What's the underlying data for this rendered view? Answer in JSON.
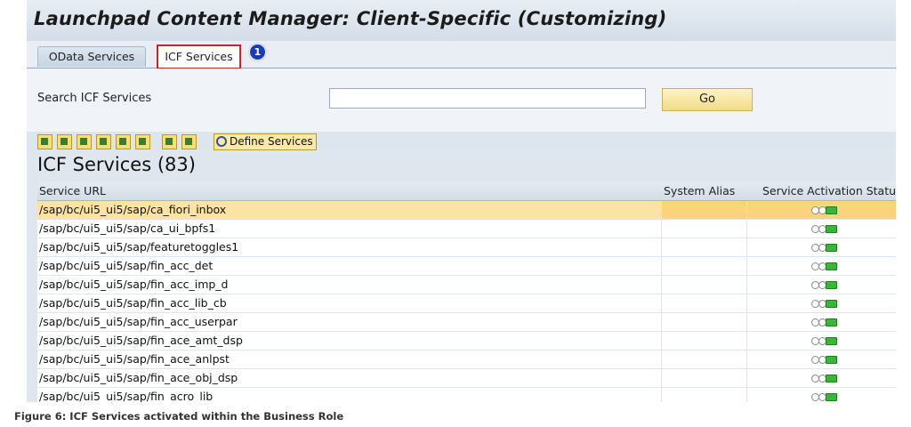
{
  "window": {
    "title": "Launchpad Content Manager: Client-Specific (Customizing)"
  },
  "tabs": [
    {
      "label": "OData Services",
      "active": false
    },
    {
      "label": "ICF Services",
      "active": true
    }
  ],
  "callout_badge": "1",
  "search": {
    "label": "Search ICF Services",
    "value": "",
    "go_label": "Go"
  },
  "toolbar": {
    "icons": [
      "details-icon",
      "upload-icon",
      "align-icon",
      "find-icon",
      "find-next-icon",
      "filter-icon",
      "export-icon",
      "layout-icon"
    ],
    "define_label": "Define Services"
  },
  "table": {
    "title": "ICF Services (83)",
    "columns": [
      "Service URL",
      "System Alias",
      "Service Activation Status"
    ],
    "rows": [
      {
        "url": "/sap/bc/ui5_ui5/sap/ca_fiori_inbox",
        "alias": "",
        "status": "active",
        "selected": true
      },
      {
        "url": "/sap/bc/ui5_ui5/sap/ca_ui_bpfs1",
        "alias": "",
        "status": "active"
      },
      {
        "url": "/sap/bc/ui5_ui5/sap/featuretoggles1",
        "alias": "",
        "status": "active"
      },
      {
        "url": "/sap/bc/ui5_ui5/sap/fin_acc_det",
        "alias": "",
        "status": "active"
      },
      {
        "url": "/sap/bc/ui5_ui5/sap/fin_acc_imp_d",
        "alias": "",
        "status": "active"
      },
      {
        "url": "/sap/bc/ui5_ui5/sap/fin_acc_lib_cb",
        "alias": "",
        "status": "active"
      },
      {
        "url": "/sap/bc/ui5_ui5/sap/fin_acc_userpar",
        "alias": "",
        "status": "active"
      },
      {
        "url": "/sap/bc/ui5_ui5/sap/fin_ace_amt_dsp",
        "alias": "",
        "status": "active"
      },
      {
        "url": "/sap/bc/ui5_ui5/sap/fin_ace_anlpst",
        "alias": "",
        "status": "active"
      },
      {
        "url": "/sap/bc/ui5_ui5/sap/fin_ace_obj_dsp",
        "alias": "",
        "status": "active"
      },
      {
        "url": "/sap/bc/ui5_ui5/sap/fin_acro_lib",
        "alias": "",
        "status": "active"
      }
    ]
  },
  "caption": "Figure 6: ICF Services activated within the Business Role",
  "colors": {
    "selected_row": "#fbe4a3",
    "tab_highlight": "#c0282d",
    "badge": "#1a3bb8",
    "status_green": "#3bb43a"
  }
}
